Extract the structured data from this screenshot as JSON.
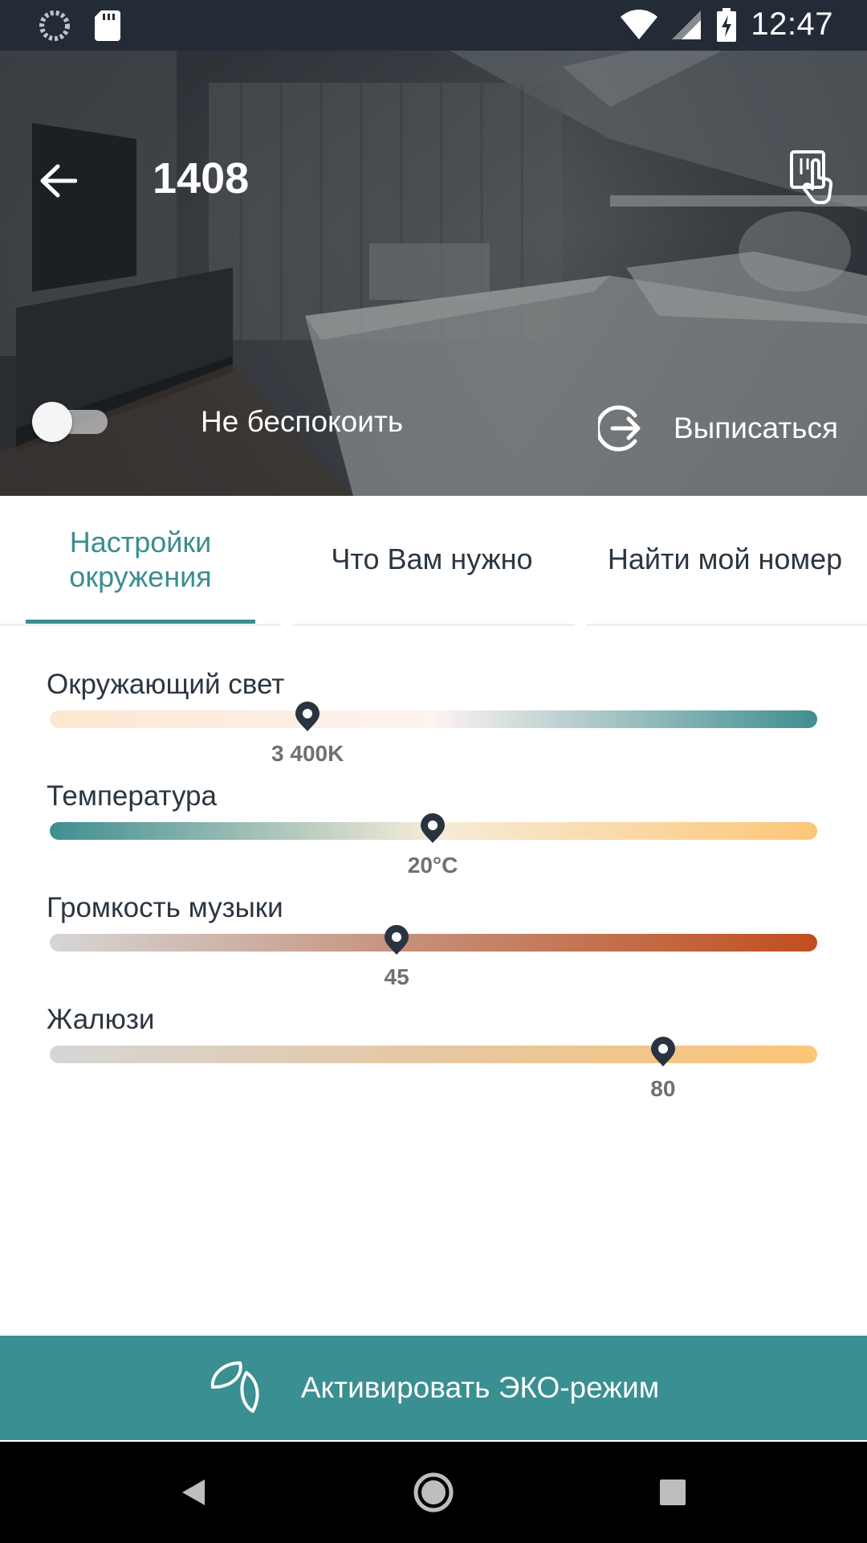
{
  "status_bar": {
    "time": "12:47",
    "icons_left": [
      "sync-icon",
      "sd-card-icon"
    ],
    "icons_right": [
      "wifi-icon",
      "cell-signal-icon",
      "battery-charging-icon"
    ]
  },
  "header": {
    "room_number": "1408",
    "back_icon": "arrow-left-icon",
    "touch_icon": "touch-card-icon"
  },
  "hero": {
    "dnd_label": "Не беспокоить",
    "dnd_on": false,
    "checkout_label": "Выписаться",
    "checkout_icon": "checkout-icon"
  },
  "tabs": [
    {
      "label_line1": "Настройки",
      "label_line2": "окружения",
      "active": true
    },
    {
      "label": "Что Вам нужно",
      "active": false
    },
    {
      "label": "Найти мой номер",
      "active": false
    }
  ],
  "sliders": [
    {
      "label": "Окружающий свет",
      "value": "3 400K",
      "position": 0.336,
      "colors": [
        "#fde7cf",
        "#fdf3f1",
        "#3f8e91"
      ]
    },
    {
      "label": "Температура",
      "value": "20°C",
      "position": 0.499,
      "colors": [
        "#3f8e91",
        "#f7ecd8",
        "#fcc678"
      ]
    },
    {
      "label": "Громкость музыки",
      "value": "45",
      "position": 0.452,
      "colors": [
        "#d6d6d6",
        "#c48c74",
        "#c24e1f"
      ]
    },
    {
      "label": "Жалюзи",
      "value": "80",
      "position": 0.799,
      "colors": [
        "#d6d6d6",
        "#e6c7a2",
        "#fcc678"
      ]
    }
  ],
  "eco": {
    "label": "Активировать ЭКО-режим",
    "icon": "leaf-icon"
  },
  "colors": {
    "accent": "#3c8d8f",
    "eco_button": "#3a8f92",
    "text_dark": "#2b3640",
    "value_gray": "#707070",
    "thumb": "#2a3440"
  }
}
